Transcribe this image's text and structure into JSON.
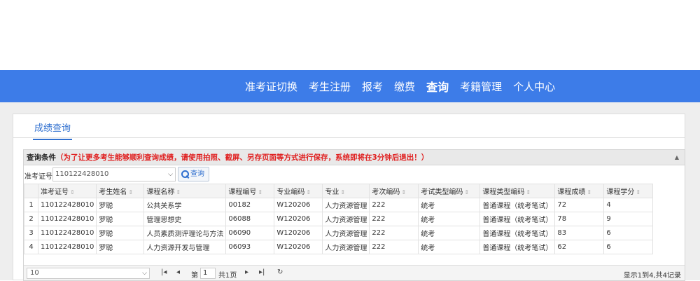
{
  "nav": {
    "items": [
      "准考证切换",
      "考生注册",
      "报考",
      "缴费",
      "查询",
      "考籍管理",
      "个人中心"
    ],
    "active": "查询"
  },
  "tab": {
    "label": "成绩查询"
  },
  "query": {
    "title": "查询条件",
    "warning": "（为了让更多考生能够顺利查询成绩，请使用拍照、截屏、另存页面等方式进行保存，系统即将在3分钟后退出！）",
    "ticket_label": "准考证号",
    "ticket_value": "110122428010",
    "search_label": "查询"
  },
  "table": {
    "headers": [
      "准考证号",
      "考生姓名",
      "课程名称",
      "课程编号",
      "专业编码",
      "专业",
      "考次编码",
      "考试类型编码",
      "课程类型编码",
      "课程成绩",
      "课程学分"
    ],
    "rows": [
      [
        "1",
        "110122428010",
        "罗聪",
        "公共关系学",
        "00182",
        "W120206",
        "人力资源管理",
        "222",
        "统考",
        "普通课程（统考笔试）",
        "72",
        "4"
      ],
      [
        "2",
        "110122428010",
        "罗聪",
        "管理思想史",
        "06088",
        "W120206",
        "人力资源管理",
        "222",
        "统考",
        "普通课程（统考笔试）",
        "78",
        "9"
      ],
      [
        "3",
        "110122428010",
        "罗聪",
        "人员素质测评理论与方法",
        "06090",
        "W120206",
        "人力资源管理",
        "222",
        "统考",
        "普通课程（统考笔试）",
        "83",
        "6"
      ],
      [
        "4",
        "110122428010",
        "罗聪",
        "人力资源开发与管理",
        "06093",
        "W120206",
        "人力资源管理",
        "222",
        "统考",
        "普通课程（统考笔试）",
        "62",
        "6"
      ]
    ]
  },
  "pager": {
    "page_size": "10",
    "page_prefix": "第",
    "page_value": "1",
    "page_suffix": "共1页",
    "summary": "显示1到4,共4记录"
  },
  "colors": {
    "nav_bg": "#3d7ce8",
    "tab_active": "#2f6fcf",
    "warning": "#e02020"
  },
  "icons": [
    "search-icon",
    "chevron-down-icon",
    "first-page-icon",
    "prev-page-icon",
    "next-page-icon",
    "last-page-icon",
    "refresh-icon",
    "collapse-arrow-icon",
    "sort-icon"
  ]
}
